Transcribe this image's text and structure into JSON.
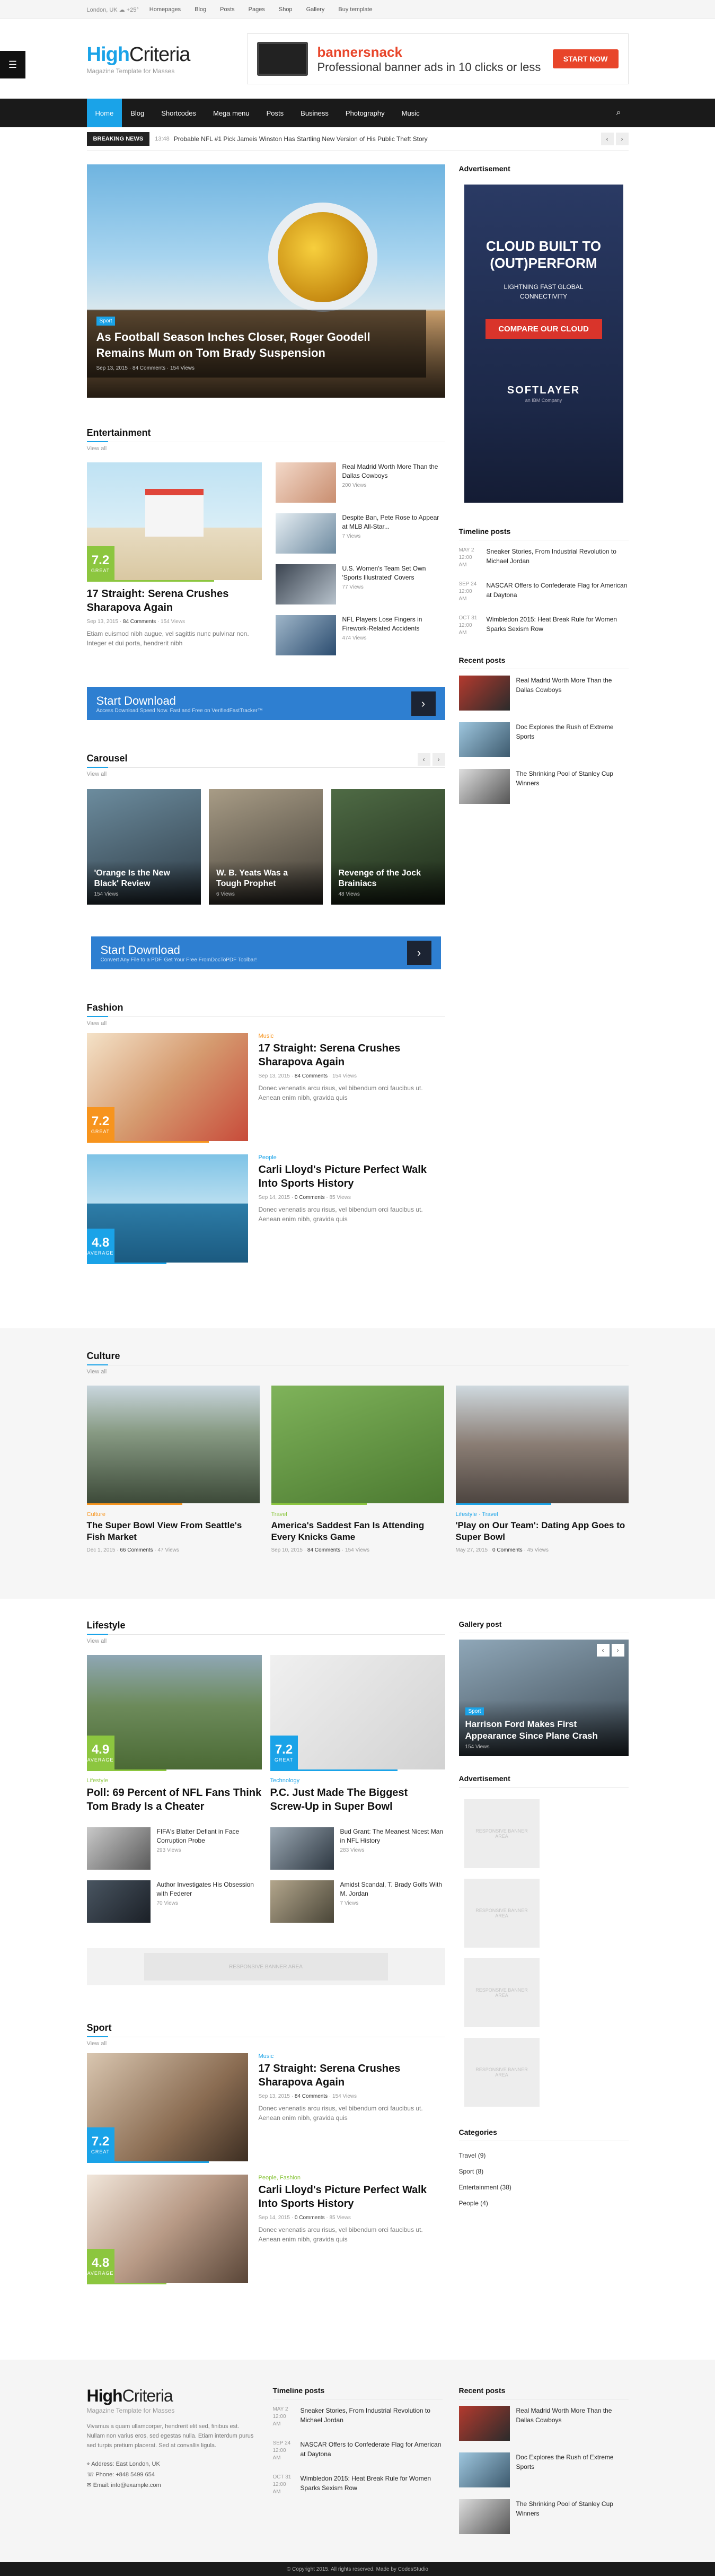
{
  "topbar": {
    "weather": "London, UK ☁ +25°",
    "links": [
      "Homepages",
      "Blog",
      "Posts",
      "Pages",
      "Shop",
      "Gallery",
      "Buy template"
    ]
  },
  "logo": {
    "name_a": "High",
    "name_b": "Criteria",
    "tagline": "Magazine Template for Masses"
  },
  "header_ad": {
    "brand": "bannersnack",
    "tagline": "Professional banner ads in 10 clicks or less",
    "button": "START NOW"
  },
  "nav": {
    "items": [
      "Home",
      "Blog",
      "Shortcodes",
      "Mega menu",
      "Posts",
      "Business",
      "Photography",
      "Music"
    ]
  },
  "breaking": {
    "label": "BREAKING NEWS",
    "time": "13:48",
    "text": "Probable NFL #1 Pick Jameis Winston Has Startling New Version of His Public Theft Story"
  },
  "featured": {
    "category": "Sport",
    "title": "As Football Season Inches Closer, Roger Goodell Remains Mum on Tom Brady Suspension",
    "date": "Sep 13, 2015",
    "comments": "84 Comments",
    "views": "154 Views"
  },
  "entertainment": {
    "title": "Entertainment",
    "view_all": "View all",
    "main": {
      "score": "7.2",
      "score_label": "GREAT",
      "title": "17 Straight: Serena Crushes Sharapova Again",
      "date": "Sep 13, 2015",
      "comments": "84 Comments",
      "views": "154 Views",
      "excerpt": "Etiam euismod nibh augue, vel sagittis nunc pulvinar non. Integer et dui porta, hendrerit nibh"
    },
    "list": [
      {
        "title": "Real Madrid Worth More Than the Dallas Cowboys",
        "views": "200 Views"
      },
      {
        "title": "Despite Ban, Pete Rose to Appear at MLB All-Star...",
        "views": "7 Views"
      },
      {
        "title": "U.S. Women's Team Set Own 'Sports Illustrated' Covers",
        "views": "77 Views"
      },
      {
        "title": "NFL Players Lose Fingers in Firework-Related Accidents",
        "views": "474 Views"
      }
    ]
  },
  "ad1": {
    "title": "Start Download",
    "sub": "Access Download Speed Now. Fast and Free on VerifiedFastTracker™"
  },
  "carousel": {
    "title": "Carousel",
    "view_all": "View all",
    "items": [
      {
        "title": "'Orange Is the New Black' Review",
        "views": "154 Views"
      },
      {
        "title": "W. B. Yeats Was a Tough Prophet",
        "views": "6 Views"
      },
      {
        "title": "Revenge of the Jock Brainiacs",
        "views": "48 Views"
      }
    ]
  },
  "ad2": {
    "title": "Start Download",
    "sub": "Convert Any File to a PDF. Get Your Free FromDocToPDF Toolbar!"
  },
  "fashion": {
    "title": "Fashion",
    "view_all": "View all",
    "items": [
      {
        "cat": "Music",
        "score": "7.2",
        "score_label": "GREAT",
        "title": "17 Straight: Serena Crushes Sharapova Again",
        "date": "Sep 13, 2015",
        "comments": "84 Comments",
        "views": "154 Views",
        "excerpt": "Donec venenatis arcu risus, vel bibendum orci faucibus ut. Aenean enim nibh, gravida quis"
      },
      {
        "cat": "People",
        "score": "4.8",
        "score_label": "AVERAGE",
        "title": "Carli Lloyd's Picture Perfect Walk Into Sports History",
        "date": "Sep 14, 2015",
        "comments": "0 Comments",
        "views": "85 Views",
        "excerpt": "Donec venenatis arcu risus, vel bibendum orci faucibus ut. Aenean enim nibh, gravida quis"
      }
    ]
  },
  "sidebar": {
    "ad_title": "Advertisement",
    "ad": {
      "line1": "CLOUD BUILT TO",
      "line2": "(OUT)PERFORM",
      "sub": "LIGHTNING FAST GLOBAL CONNECTIVITY",
      "button": "COMPARE OUR CLOUD",
      "brand": "SOFTLAYER",
      "brand_sub": "an IBM Company"
    },
    "timeline_title": "Timeline posts",
    "timeline": [
      {
        "date": "MAY 2",
        "time": "12:00 AM",
        "title": "Sneaker Stories, From Industrial Revolution to Michael Jordan"
      },
      {
        "date": "SEP 24",
        "time": "12:00 AM",
        "title": "NASCAR Offers to Confederate Flag for American at Daytona"
      },
      {
        "date": "OCT 31",
        "time": "12:00 AM",
        "title": "Wimbledon 2015: Heat Break Rule for Women Sparks Sexism Row"
      }
    ],
    "recent_title": "Recent posts",
    "recent": [
      {
        "title": "Real Madrid Worth More Than the Dallas Cowboys"
      },
      {
        "title": "Doc Explores the Rush of Extreme Sports"
      },
      {
        "title": "The Shrinking Pool of Stanley Cup Winners"
      }
    ]
  },
  "culture": {
    "title": "Culture",
    "view_all": "View all",
    "items": [
      {
        "cat": "Culture",
        "title": "The Super Bowl View From Seattle's Fish Market",
        "date": "Dec 1, 2015",
        "comments": "66 Comments",
        "views": "47 Views"
      },
      {
        "cat": "Travel",
        "title": "America's Saddest Fan Is Attending Every Knicks Game",
        "date": "Sep 10, 2015",
        "comments": "84 Comments",
        "views": "154 Views"
      },
      {
        "cat": "Lifestyle · Travel",
        "title": "'Play on Our Team': Dating App Goes to Super Bowl",
        "date": "May 27, 2015",
        "comments": "0 Comments",
        "views": "45 Views"
      }
    ]
  },
  "lifestyle": {
    "title": "Lifestyle",
    "view_all": "View all",
    "main": [
      {
        "cat": "Lifestyle",
        "score": "4.9",
        "score_label": "AVERAGE",
        "title": "Poll: 69 Percent of NFL Fans Think Tom Brady Is a Cheater"
      },
      {
        "cat": "Technology",
        "score": "7.2",
        "score_label": "GREAT",
        "title": "P.C. Just Made The Biggest Screw-Up in Super Bowl"
      }
    ],
    "small": [
      {
        "title": "FIFA's Blatter Defiant in Face Corruption Probe",
        "views": "293 Views"
      },
      {
        "title": "Bud Grant: The Meanest Nicest Man in NFL History",
        "views": "283 Views"
      },
      {
        "title": "Author Investigates His Obsession with Federer",
        "views": "70 Views"
      },
      {
        "title": "Amidst Scandal, T. Brady Golfs With M. Jordan",
        "views": "7 Views"
      }
    ],
    "banner_text": "RESPONSIVE BANNER AREA"
  },
  "gallery": {
    "title": "Gallery post",
    "cat": "Sport",
    "post_title": "Harrison Ford Makes First Appearance Since Plane Crash",
    "views": "154 Views"
  },
  "ads2": {
    "title": "Advertisement",
    "box": "RESPONSIVE BANNER AREA"
  },
  "categories": {
    "title": "Categories",
    "items": [
      "Travel (9)",
      "Sport (8)",
      "Entertainment (38)",
      "People (4)"
    ]
  },
  "sport": {
    "title": "Sport",
    "view_all": "View all",
    "items": [
      {
        "cat": "Music",
        "score": "7.2",
        "score_label": "GREAT",
        "title": "17 Straight: Serena Crushes Sharapova Again",
        "date": "Sep 13, 2015",
        "comments": "84 Comments",
        "views": "154 Views",
        "excerpt": "Donec venenatis arcu risus, vel bibendum orci faucibus ut. Aenean enim nibh, gravida quis"
      },
      {
        "cat": "People, Fashion",
        "score": "4.8",
        "score_label": "AVERAGE",
        "title": "Carli Lloyd's Picture Perfect Walk Into Sports History",
        "date": "Sep 14, 2015",
        "comments": "0 Comments",
        "views": "85 Views",
        "excerpt": "Donec venenatis arcu risus, vel bibendum orci faucibus ut. Aenean enim nibh, gravida quis"
      }
    ]
  },
  "footer": {
    "about": "Vivamus a quam ullamcorper, hendrerit elit sed, finibus est. Nullam non varius eros, sed egestas nulla. Etiam interdum purus sed turpis pretium placerat. Sed at convallis ligula.",
    "address": "Address: East London, UK",
    "phone": "Phone: +848 5499 654",
    "email": "Email: info@example.com",
    "copyright": "© Copyright 2015. All rights reserved. Made by CodesStudio"
  },
  "colors": {
    "accent": "#1aa3e8",
    "score_green": "#8cc63f",
    "score_orange": "#f7941d",
    "score_blue": "#1aa3e8",
    "nav_bg": "#1a1a1a"
  }
}
